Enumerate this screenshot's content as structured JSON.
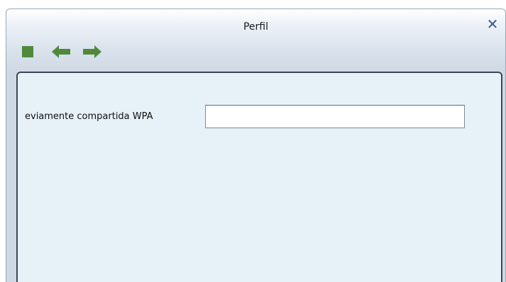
{
  "window": {
    "title": "Perfil",
    "close_label": "✕"
  },
  "toolbar": {
    "stop_icon": "stop-square-icon",
    "back_icon": "arrow-left-icon",
    "forward_icon": "arrow-right-icon",
    "icon_color": "#4f8a3b"
  },
  "form": {
    "wpa_psk_label": "eviamente compartida WPA",
    "wpa_psk_value": "",
    "wpa_psk_placeholder": ""
  },
  "colors": {
    "panel_background": "#e7f1f8",
    "close_icon": "#3a5a88"
  }
}
